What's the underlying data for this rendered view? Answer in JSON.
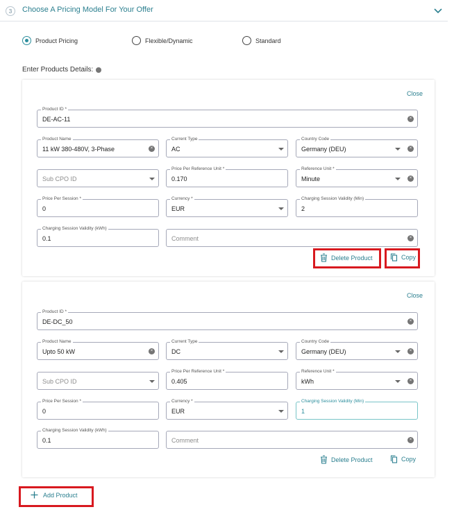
{
  "step": {
    "number": "3",
    "title": "Choose A Pricing Model For Your Offer"
  },
  "pricing_models": [
    {
      "label": "Product Pricing",
      "selected": true
    },
    {
      "label": "Flexible/Dynamic",
      "selected": false
    },
    {
      "label": "Standard",
      "selected": false
    }
  ],
  "section_label": "Enter Products Details:",
  "labels": {
    "close": "Close",
    "product_id": "Product ID *",
    "product_name": "Product Name",
    "current_type": "Current Type",
    "country_code": "Country Code",
    "sub_cpo_id": "Sub CPO ID",
    "price_per_unit": "Price Per Reference Unit *",
    "reference_unit": "Reference Unit *",
    "price_per_session": "Price Per Session *",
    "currency": "Currency *",
    "validity_min": "Charging Session Validity (Min)",
    "validity_kwh": "Charging Session Validity (kWh)",
    "comment": "Comment",
    "delete_product": "Delete Product",
    "copy": "Copy",
    "add_product": "Add Product"
  },
  "products": [
    {
      "product_id": "DE-AC-11",
      "product_name": "11 kW 380-480V, 3-Phase",
      "current_type": "AC",
      "country_code": "Germany (DEU)",
      "price_per_unit": "0.170",
      "reference_unit": "Minute",
      "price_per_session": "0",
      "currency": "EUR",
      "validity_min": "2",
      "validity_kwh": "0.1"
    },
    {
      "product_id": "DE-DC_50",
      "product_name": "Upto 50 kW",
      "current_type": "DC",
      "country_code": "Germany (DEU)",
      "price_per_unit": "0.405",
      "reference_unit": "kWh",
      "price_per_session": "0",
      "currency": "EUR",
      "validity_min": "1",
      "validity_kwh": "0.1"
    }
  ],
  "colors": {
    "accent": "#2a8d9c",
    "highlight": "#d8191f",
    "field_border": "#a5a8b8"
  },
  "icons": {
    "delete": "trash-icon",
    "copy": "copy-icon",
    "add": "plus-icon",
    "expand": "chevron-down-icon"
  }
}
